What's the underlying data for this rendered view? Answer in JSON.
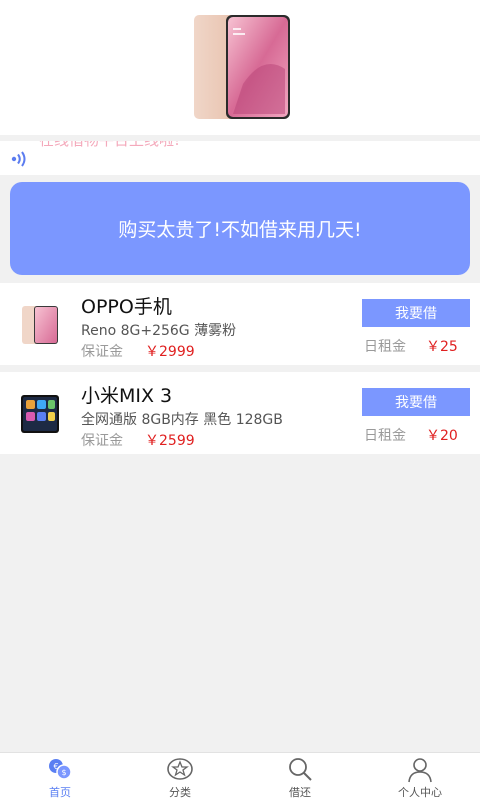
{
  "banner": {
    "image": "phone-banner-image"
  },
  "notice": {
    "icon": "broadcast-icon",
    "text": "在线借物平台上线啦!"
  },
  "promo": {
    "text": "购买太贵了!不如借来用几天!"
  },
  "products": [
    {
      "name": "OPPO手机",
      "spec": "Reno 8G+256G 薄雾粉",
      "deposit_label": "保证金",
      "deposit": "￥2999",
      "button": "我要借",
      "rent_label": "日租金",
      "rent": "￥25"
    },
    {
      "name": "小米MIX 3",
      "spec": " 全网通版 8GB内存 黑色 128GB",
      "deposit_label": "保证金",
      "deposit": "￥2599",
      "button": "我要借",
      "rent_label": "日租金",
      "rent": "￥20"
    }
  ],
  "tabs": [
    {
      "label": "首页",
      "icon": "home-coins-icon",
      "active": true
    },
    {
      "label": "分类",
      "icon": "category-star-icon",
      "active": false
    },
    {
      "label": "借还",
      "icon": "search-icon",
      "active": false
    },
    {
      "label": "个人中心",
      "icon": "user-icon",
      "active": false
    }
  ],
  "colors": {
    "accent": "#7b97ff",
    "price": "#e02020",
    "tab_active": "#5a7ff2"
  }
}
